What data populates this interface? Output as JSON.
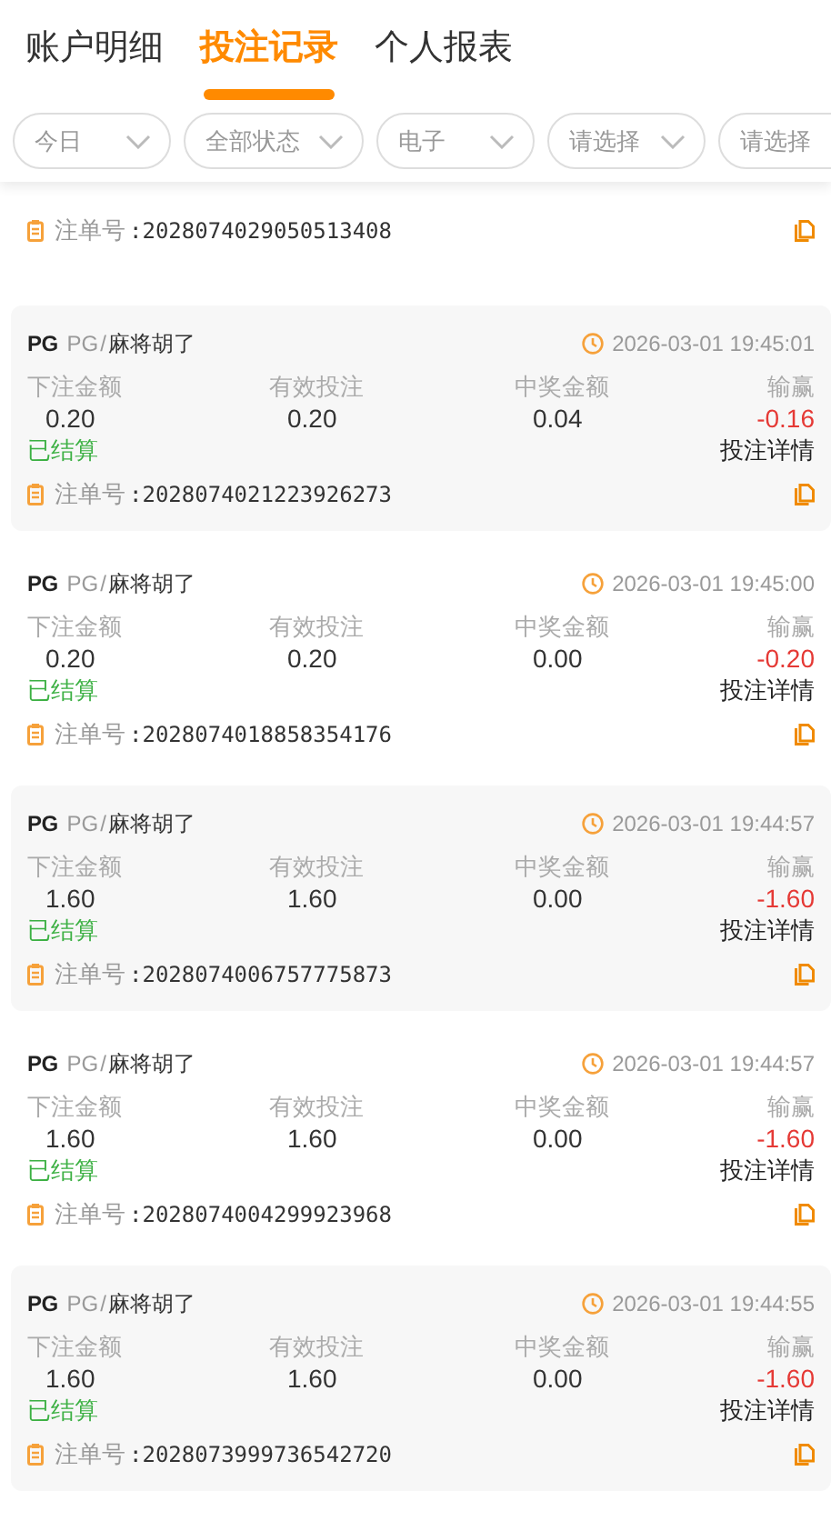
{
  "tabs": [
    {
      "label": "账户明细",
      "selected": false
    },
    {
      "label": "投注记录",
      "selected": true
    },
    {
      "label": "个人报表",
      "selected": false
    }
  ],
  "filters": [
    {
      "label": "今日"
    },
    {
      "label": "全部状态"
    },
    {
      "label": "电子"
    },
    {
      "label": "请选择"
    },
    {
      "label": "请选择"
    }
  ],
  "partial_record": {
    "order_label": "注单号",
    "order_no": ":2028074029050513408"
  },
  "records": [
    {
      "logo": "PG",
      "provider": "PG",
      "separator": "/",
      "game": "麻将胡了",
      "time": "2026-03-01 19:45:01",
      "bet_label": "下注金额",
      "valid_label": "有效投注",
      "win_label": "中奖金额",
      "profit_label": "输赢",
      "bet": "0.20",
      "valid": "0.20",
      "win": "0.04",
      "profit": "-0.16",
      "status": "已结算",
      "detail_link": "投注详情",
      "order_label": "注单号",
      "order_no": ":2028074021223926273"
    },
    {
      "logo": "PG",
      "provider": "PG",
      "separator": "/",
      "game": "麻将胡了",
      "time": "2026-03-01 19:45:00",
      "bet_label": "下注金额",
      "valid_label": "有效投注",
      "win_label": "中奖金额",
      "profit_label": "输赢",
      "bet": "0.20",
      "valid": "0.20",
      "win": "0.00",
      "profit": "-0.20",
      "status": "已结算",
      "detail_link": "投注详情",
      "order_label": "注单号",
      "order_no": ":2028074018858354176"
    },
    {
      "logo": "PG",
      "provider": "PG",
      "separator": "/",
      "game": "麻将胡了",
      "time": "2026-03-01 19:44:57",
      "bet_label": "下注金额",
      "valid_label": "有效投注",
      "win_label": "中奖金额",
      "profit_label": "输赢",
      "bet": "1.60",
      "valid": "1.60",
      "win": "0.00",
      "profit": "-1.60",
      "status": "已结算",
      "detail_link": "投注详情",
      "order_label": "注单号",
      "order_no": ":2028074006757775873"
    },
    {
      "logo": "PG",
      "provider": "PG",
      "separator": "/",
      "game": "麻将胡了",
      "time": "2026-03-01 19:44:57",
      "bet_label": "下注金额",
      "valid_label": "有效投注",
      "win_label": "中奖金额",
      "profit_label": "输赢",
      "bet": "1.60",
      "valid": "1.60",
      "win": "0.00",
      "profit": "-1.60",
      "status": "已结算",
      "detail_link": "投注详情",
      "order_label": "注单号",
      "order_no": ":2028074004299923968"
    },
    {
      "logo": "PG",
      "provider": "PG",
      "separator": "/",
      "game": "麻将胡了",
      "time": "2026-03-01 19:44:55",
      "bet_label": "下注金额",
      "valid_label": "有效投注",
      "win_label": "中奖金额",
      "profit_label": "输赢",
      "bet": "1.60",
      "valid": "1.60",
      "win": "0.00",
      "profit": "-1.60",
      "status": "已结算",
      "detail_link": "投注详情",
      "order_label": "注单号",
      "order_no": ":2028073999736542720"
    }
  ]
}
